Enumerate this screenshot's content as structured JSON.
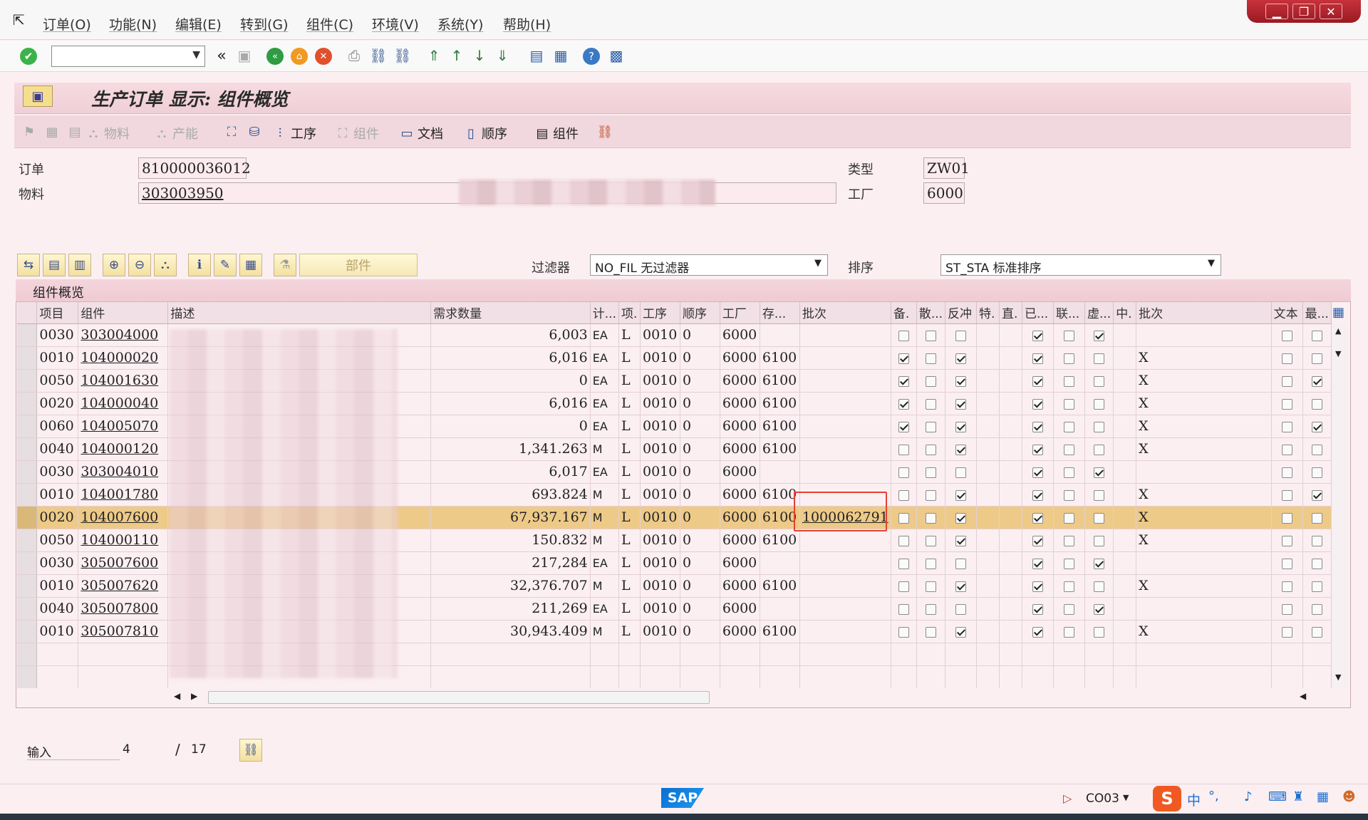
{
  "menu": [
    "订单(O)",
    "功能(N)",
    "编辑(E)",
    "转到(G)",
    "组件(C)",
    "环境(V)",
    "系统(Y)",
    "帮助(H)"
  ],
  "title": "生产订单 显示: 组件概览",
  "app_toolbar": {
    "material": "物料",
    "capacity": "产能",
    "operation": "工序",
    "component": "组件",
    "document": "文档",
    "sequence": "顺序",
    "component2": "组件"
  },
  "header": {
    "order_label": "订单",
    "order_value": "810000036012",
    "material_label": "物料",
    "material_value": "303003950",
    "type_label": "类型",
    "type_value": "ZW01",
    "plant_label": "工厂",
    "plant_value": "6000"
  },
  "filter": {
    "label": "过滤器",
    "value": "NO_FIL 无过滤器"
  },
  "sort": {
    "label": "排序",
    "value": "ST_STA 标准排序"
  },
  "part_button": "部件",
  "panel_title": "组件概览",
  "columns": [
    "项目",
    "组件",
    "描述",
    "需求数量",
    "计...",
    "项.",
    "工序",
    "顺序",
    "工厂",
    "存...",
    "批次",
    "备.",
    "散...",
    "反冲",
    "特.",
    "直.",
    "已...",
    "联...",
    "虚...",
    "中.",
    "批次",
    "文本",
    "最..."
  ],
  "rows": [
    {
      "item": "0030",
      "comp": "303004000",
      "qty": "6,003",
      "uom": "EA",
      "cat": "L",
      "op": "0010",
      "seq": "0",
      "plant": "6000",
      "sloc": "",
      "batch": "",
      "cb": [
        0,
        0,
        0,
        0,
        1,
        0,
        1
      ],
      "x": "",
      "text": 0,
      "last": 0
    },
    {
      "item": "0010",
      "comp": "104000020",
      "qty": "6,016",
      "uom": "EA",
      "cat": "L",
      "op": "0010",
      "seq": "0",
      "plant": "6000",
      "sloc": "6100",
      "batch": "",
      "cb": [
        1,
        0,
        1,
        0,
        1,
        0,
        0
      ],
      "x": "X",
      "text": 0,
      "last": 0
    },
    {
      "item": "0050",
      "comp": "104001630",
      "qty": "0",
      "uom": "EA",
      "cat": "L",
      "op": "0010",
      "seq": "0",
      "plant": "6000",
      "sloc": "6100",
      "batch": "",
      "cb": [
        1,
        0,
        1,
        0,
        1,
        0,
        0
      ],
      "x": "X",
      "text": 0,
      "last": 1
    },
    {
      "item": "0020",
      "comp": "104000040",
      "qty": "6,016",
      "uom": "EA",
      "cat": "L",
      "op": "0010",
      "seq": "0",
      "plant": "6000",
      "sloc": "6100",
      "batch": "",
      "cb": [
        1,
        0,
        1,
        0,
        1,
        0,
        0
      ],
      "x": "X",
      "text": 0,
      "last": 0
    },
    {
      "item": "0060",
      "comp": "104005070",
      "qty": "0",
      "uom": "EA",
      "cat": "L",
      "op": "0010",
      "seq": "0",
      "plant": "6000",
      "sloc": "6100",
      "batch": "",
      "cb": [
        1,
        0,
        1,
        0,
        1,
        0,
        0
      ],
      "x": "X",
      "text": 0,
      "last": 1
    },
    {
      "item": "0040",
      "comp": "104000120",
      "qty": "1,341.263",
      "uom": "M",
      "cat": "L",
      "op": "0010",
      "seq": "0",
      "plant": "6000",
      "sloc": "6100",
      "batch": "",
      "cb": [
        0,
        0,
        1,
        0,
        1,
        0,
        0
      ],
      "x": "X",
      "text": 0,
      "last": 0
    },
    {
      "item": "0030",
      "comp": "303004010",
      "qty": "6,017",
      "uom": "EA",
      "cat": "L",
      "op": "0010",
      "seq": "0",
      "plant": "6000",
      "sloc": "",
      "batch": "",
      "cb": [
        0,
        0,
        0,
        0,
        1,
        0,
        1
      ],
      "x": "",
      "text": 0,
      "last": 0
    },
    {
      "item": "0010",
      "comp": "104001780",
      "qty": "693.824",
      "uom": "M",
      "cat": "L",
      "op": "0010",
      "seq": "0",
      "plant": "6000",
      "sloc": "6100",
      "batch": "",
      "cb": [
        0,
        0,
        1,
        0,
        1,
        0,
        0
      ],
      "x": "X",
      "text": 0,
      "last": 1
    },
    {
      "item": "0020",
      "comp": "104007600",
      "qty": "67,937.167",
      "uom": "M",
      "cat": "L",
      "op": "0010",
      "seq": "0",
      "plant": "6000",
      "sloc": "6100",
      "batch": "1000062791",
      "cb": [
        0,
        0,
        1,
        0,
        1,
        0,
        0
      ],
      "x": "X",
      "text": 0,
      "last": 0
    },
    {
      "item": "0050",
      "comp": "104000110",
      "qty": "150.832",
      "uom": "M",
      "cat": "L",
      "op": "0010",
      "seq": "0",
      "plant": "6000",
      "sloc": "6100",
      "batch": "",
      "cb": [
        0,
        0,
        1,
        0,
        1,
        0,
        0
      ],
      "x": "X",
      "text": 0,
      "last": 0
    },
    {
      "item": "0030",
      "comp": "305007600",
      "qty": "217,284",
      "uom": "EA",
      "cat": "L",
      "op": "0010",
      "seq": "0",
      "plant": "6000",
      "sloc": "",
      "batch": "",
      "cb": [
        0,
        0,
        0,
        0,
        1,
        0,
        1
      ],
      "x": "",
      "text": 0,
      "last": 0
    },
    {
      "item": "0010",
      "comp": "305007620",
      "qty": "32,376.707",
      "uom": "M",
      "cat": "L",
      "op": "0010",
      "seq": "0",
      "plant": "6000",
      "sloc": "6100",
      "batch": "",
      "cb": [
        0,
        0,
        1,
        0,
        1,
        0,
        0
      ],
      "x": "X",
      "text": 0,
      "last": 0
    },
    {
      "item": "0040",
      "comp": "305007800",
      "qty": "211,269",
      "uom": "EA",
      "cat": "L",
      "op": "0010",
      "seq": "0",
      "plant": "6000",
      "sloc": "",
      "batch": "",
      "cb": [
        0,
        0,
        0,
        0,
        1,
        0,
        1
      ],
      "x": "",
      "text": 0,
      "last": 0
    },
    {
      "item": "0010",
      "comp": "305007810",
      "qty": "30,943.409",
      "uom": "M",
      "cat": "L",
      "op": "0010",
      "seq": "0",
      "plant": "6000",
      "sloc": "6100",
      "batch": "",
      "cb": [
        0,
        0,
        1,
        0,
        1,
        0,
        0
      ],
      "x": "X",
      "text": 0,
      "last": 0
    }
  ],
  "footer": {
    "entry_label": "输入",
    "current": "4",
    "slash": "/",
    "total": "17"
  },
  "status": {
    "tcode": "CO03",
    "sap": "SAP"
  },
  "ime": {
    "lang": "中"
  }
}
